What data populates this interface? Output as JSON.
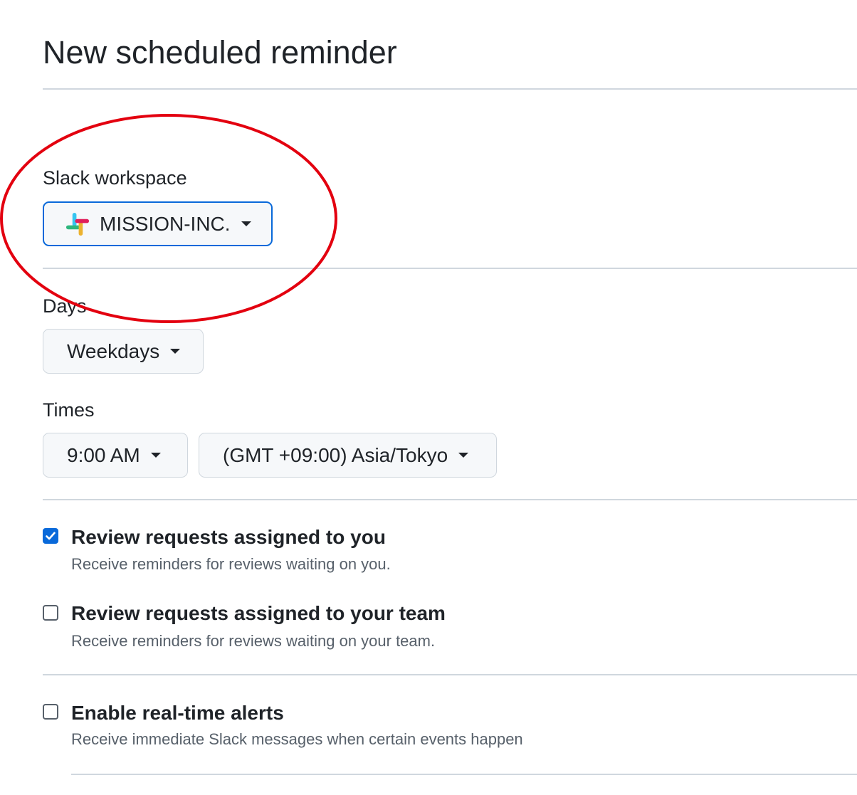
{
  "page": {
    "title": "New scheduled reminder"
  },
  "workspace": {
    "label": "Slack workspace",
    "value": "MISSION-INC.",
    "icon": "slack-logo-icon"
  },
  "days": {
    "label": "Days",
    "value": "Weekdays"
  },
  "times": {
    "label": "Times",
    "time_value": "9:00 AM",
    "timezone_value": "(GMT +09:00) Asia/Tokyo"
  },
  "options": [
    {
      "title": "Review requests assigned to you",
      "description": "Receive reminders for reviews waiting on you.",
      "checked": true
    },
    {
      "title": "Review requests assigned to your team",
      "description": "Receive reminders for reviews waiting on your team.",
      "checked": false
    },
    {
      "title": "Enable real-time alerts",
      "description": "Receive immediate Slack messages when certain events happen",
      "checked": false
    }
  ],
  "colors": {
    "accent": "#0969da",
    "annotation": "#e3000f",
    "border": "#d0d7de",
    "muted_text": "#57606a"
  }
}
